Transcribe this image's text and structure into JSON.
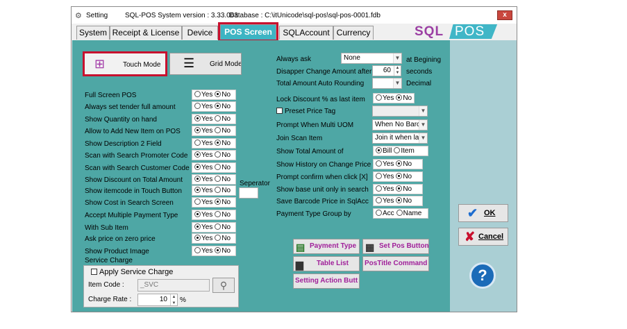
{
  "titlebar": {
    "app": "Setting",
    "version": "SQL-POS System version : 3.33.063",
    "database": "Database : C:\\itUnicode\\sql-pos\\sql-pos-0001.fdb",
    "close": "x"
  },
  "tabs": [
    "System",
    "Receipt & License",
    "Device",
    "POS Screen",
    "SQLAccount",
    "Currency"
  ],
  "active_tab": "POS Screen",
  "logo": {
    "left": "SQL",
    "right": "POS"
  },
  "modes": {
    "touch": "Touch Mode",
    "grid": "Grid Mode"
  },
  "yesno": {
    "yes": "Yes",
    "no": "No"
  },
  "left_options": [
    {
      "label": "Full Screen POS",
      "selected": "No"
    },
    {
      "label": "Always set tender full amount",
      "selected": "No"
    },
    {
      "label": "Show Quantity on hand",
      "selected": "Yes"
    },
    {
      "label": "Allow to Add New Item on POS",
      "selected": "Yes"
    },
    {
      "label": "Show Description 2 Field",
      "selected": "No"
    },
    {
      "label": "Scan with Search Promoter Code",
      "selected": "Yes"
    },
    {
      "label": "Scan with Search Customer Code",
      "selected": "Yes"
    },
    {
      "label": "Show Discount on Total Amount",
      "selected": "Yes"
    },
    {
      "label": "Show itemcode in Touch Button",
      "selected": "Yes"
    },
    {
      "label": "Show Cost in Search Screen",
      "selected": "No"
    },
    {
      "label": "Accept Multiple Payment Type",
      "selected": "Yes"
    },
    {
      "label": "With Sub Item",
      "selected": "Yes"
    },
    {
      "label": "Ask price on zero price",
      "selected": "Yes"
    },
    {
      "label": "Show Product Image",
      "selected": "No"
    }
  ],
  "separator": {
    "label": "Seperator",
    "value": ""
  },
  "service": {
    "section": "Service Charge",
    "apply": "Apply Service Charge",
    "item_code_label": "Item Code :",
    "item_code": "_SVC",
    "rate_label": "Charge Rate :",
    "rate": "10",
    "unit": "%"
  },
  "right": {
    "always_ask": {
      "label": "Always ask",
      "value": "None",
      "suffix": "at Begining"
    },
    "disappear": {
      "label": "Disapper Change Amount after",
      "value": "60",
      "suffix": "seconds"
    },
    "rounding": {
      "label": "Total Amount Auto Rounding",
      "value": "",
      "suffix": "Decimal"
    },
    "lock_discount": {
      "label": "Lock Discount % as last item",
      "selected": "No"
    },
    "preset_price": {
      "label": "Preset Price Tag",
      "value": ""
    },
    "multi_uom": {
      "label": "Prompt When Multi UOM",
      "value": "When No Barc"
    },
    "join_scan": {
      "label": "Join Scan Item",
      "value": "Join it when la:"
    },
    "total_of": {
      "label": "Show Total Amount of",
      "options": [
        "Bill",
        "Item"
      ],
      "selected": "Bill"
    },
    "history": {
      "label": "Show History on Change Price",
      "selected": "No"
    },
    "confirm_x": {
      "label": "Prompt confirm when click [X]",
      "selected": "No"
    },
    "base_unit": {
      "label": "Show base unit only in search",
      "selected": "No"
    },
    "save_barcode": {
      "label": "Save Barcode Price in SqlAcc",
      "selected": "No"
    },
    "payment_group": {
      "label": "Payment Type Group by",
      "options": [
        "Acc",
        "Name"
      ],
      "selected": ""
    }
  },
  "actions": {
    "payment_type": "Payment Type",
    "set_pos_button": "Set Pos Button",
    "table_list": "Table List",
    "pos_title": "PosTitle Command",
    "setting_action": "Setting Action Butt"
  },
  "side": {
    "ok": "OK",
    "cancel": "Cancel",
    "help": "?"
  }
}
